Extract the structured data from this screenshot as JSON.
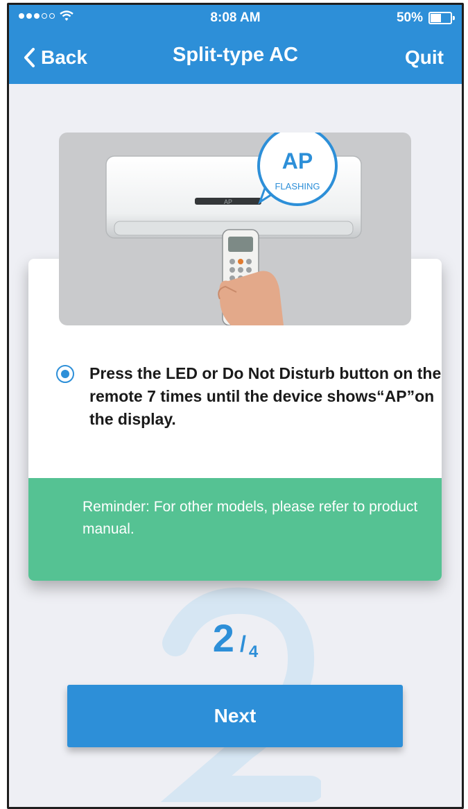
{
  "status_bar": {
    "time": "8:08 AM",
    "battery": "50%"
  },
  "nav": {
    "back_label": "Back",
    "title": "Split-type AC",
    "quit_label": "Quit"
  },
  "illustration": {
    "bubble_main": "AP",
    "bubble_sub": "FLASHING",
    "display_text": "AP"
  },
  "instruction": {
    "text": "Press the LED or Do Not Disturb button on the remote 7 times until the device shows“AP”on the display.",
    "selected": true
  },
  "reminder": {
    "text": "Reminder: For other models, please refer to product manual."
  },
  "step": {
    "current": "2",
    "separator": "/",
    "total": "4"
  },
  "next_button": {
    "label": "Next"
  },
  "colors": {
    "primary": "#2d8fd8",
    "reminder_bg": "#55c293",
    "page_bg": "#eeeff4"
  }
}
